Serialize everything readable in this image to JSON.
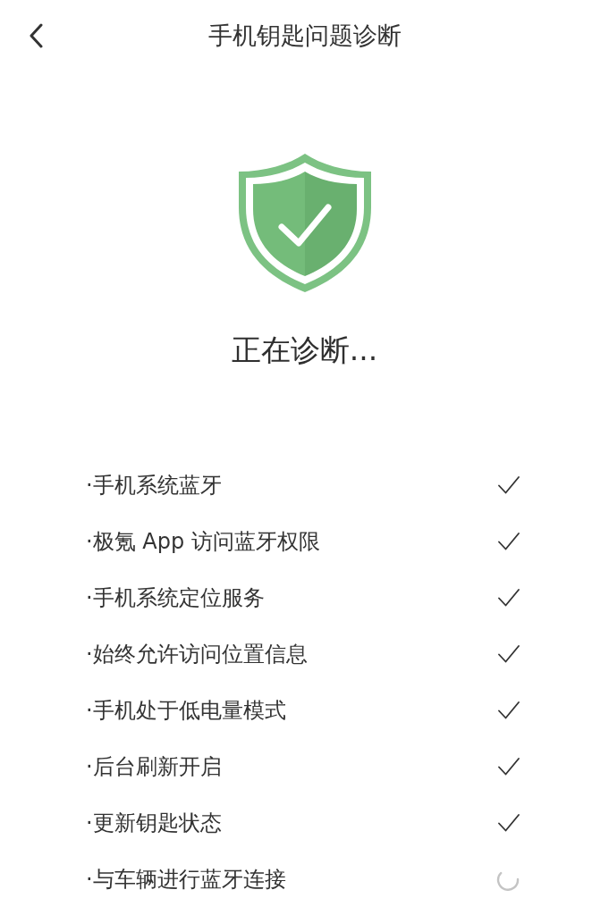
{
  "header": {
    "title": "手机钥匙问题诊断"
  },
  "status_title": "正在诊断...",
  "items": [
    {
      "label": "·手机系统蓝牙",
      "kind": "done"
    },
    {
      "label": "·极氪 App 访问蓝牙权限",
      "kind": "done"
    },
    {
      "label": "·手机系统定位服务",
      "kind": "done"
    },
    {
      "label": "·始终允许访问位置信息",
      "kind": "done"
    },
    {
      "label": "·手机处于低电量模式",
      "kind": "done"
    },
    {
      "label": "·后台刷新开启",
      "kind": "done"
    },
    {
      "label": "·更新钥匙状态",
      "kind": "done"
    },
    {
      "label": "·与车辆进行蓝牙连接",
      "kind": "loading"
    }
  ]
}
